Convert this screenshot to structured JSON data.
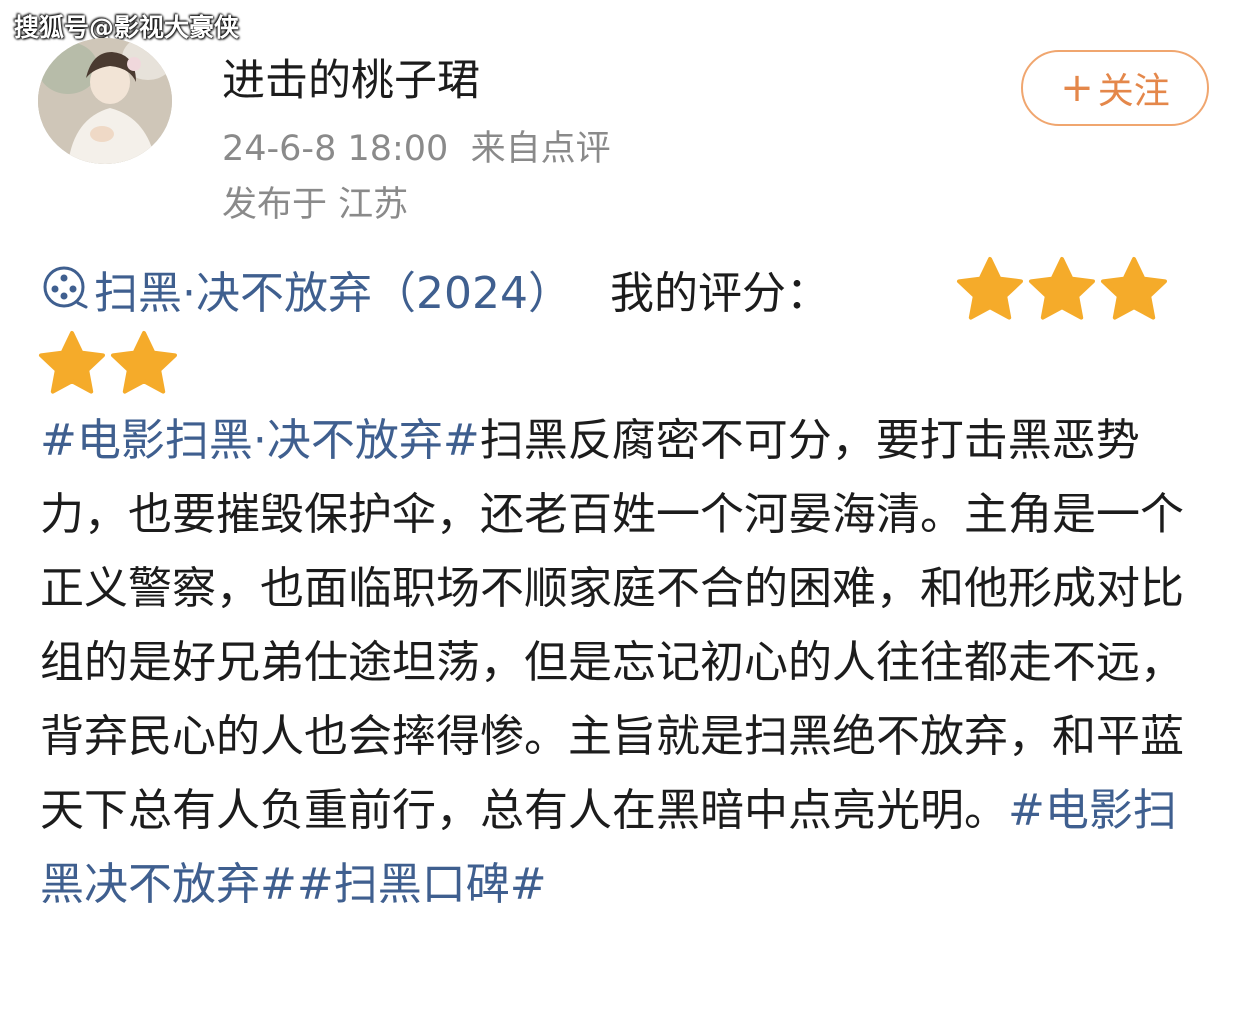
{
  "watermark": "搜狐号@影视大豪侠",
  "user": {
    "name": "进击的桃子珺",
    "datetime": "24-6-8 18:00",
    "source": "来自点评",
    "location": "发布于 江苏"
  },
  "follow": {
    "plus": "+",
    "label": "关注"
  },
  "movie": {
    "icon": "film-reel-icon",
    "title": "扫黑·决不放弃（2024）",
    "rating_label": "我的评分：",
    "rating": 5,
    "rating_max": 5
  },
  "post": {
    "tag1": "#电影扫黑·决不放弃#",
    "body": "扫黑反腐密不可分，要打击黑恶势力，也要摧毁保护伞，还老百姓一个河晏海清。主角是一个正义警察，也面临职场不顺家庭不合的困难，和他形成对比组的是好兄弟仕途坦荡，但是忘记初心的人往往都走不远，背弃民心的人也会摔得惨。主旨就是扫黑绝不放弃，和平蓝天下总有人负重前行，总有人在黑暗中点亮光明。",
    "tag2": "#电影扫黑决不放弃#",
    "tag3": "#扫黑口碑#"
  },
  "colors": {
    "tag": "#3f5f8f",
    "star": "#f5ab2a",
    "follow": "#e4874a",
    "meta": "#8a8a8a"
  }
}
